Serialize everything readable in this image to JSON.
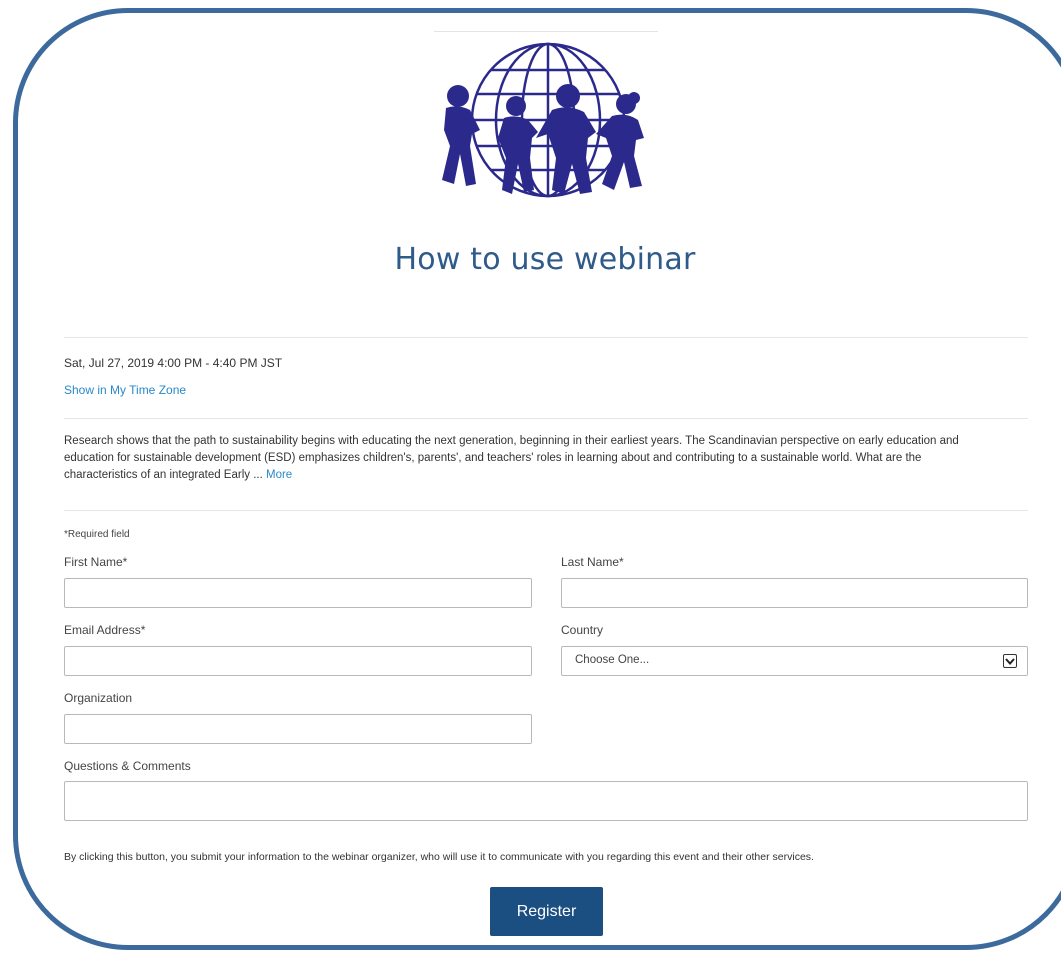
{
  "event": {
    "title": "How to use webinar",
    "datetime": "Sat, Jul 27, 2019 4:00 PM - 4:40 PM JST",
    "timezone_link": "Show in My Time Zone",
    "description": "Research shows that the path to sustainability begins with educating the next generation, beginning in their earliest years.  The Scandinavian perspective on early education and education for sustainable development (ESD) emphasizes children's, parents', and teachers' roles in learning about and contributing to a sustainable world. What are the characteristics of an integrated Early ...",
    "more_link": "More"
  },
  "form": {
    "required_note": "*Required field",
    "first_name_label": "First Name*",
    "last_name_label": "Last Name*",
    "email_label": "Email Address*",
    "country_label": "Country",
    "country_selected": "Choose One...",
    "organization_label": "Organization",
    "comments_label": "Questions & Comments",
    "disclaimer": "By clicking this button, you submit your information to the webinar organizer, who will use it to communicate with you regarding this event and their other services.",
    "register_label": "Register"
  },
  "icons": {
    "logo": "globe-with-children-logo",
    "select_arrow": "chevron-down-icon"
  },
  "colors": {
    "frame_border": "#3d6a9c",
    "title": "#2e5b8a",
    "link": "#2a88c8",
    "button": "#1b4f82",
    "logo": "#2b2a8c"
  }
}
